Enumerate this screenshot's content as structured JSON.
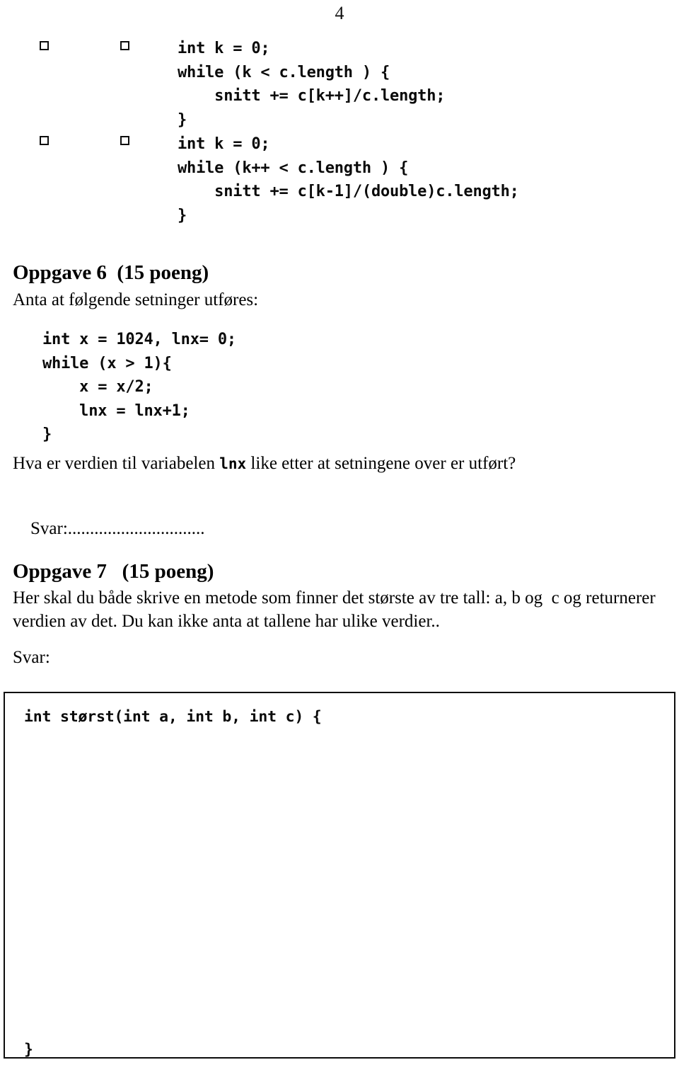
{
  "document": {
    "page_number": "4",
    "language": "no"
  },
  "checkbox_rows": [
    {
      "name": "alternative-c",
      "checkbox_left_state": "unchecked",
      "checkbox_right_state": "unchecked",
      "code": "int k = 0;\nwhile (k < c.length ) {\n    snitt += c[k++]/c.length;\n}"
    },
    {
      "name": "alternative-d",
      "checkbox_left_state": "unchecked",
      "checkbox_right_state": "unchecked",
      "code": "int k = 0;\nwhile (k++ < c.length ) {\n    snitt += c[k-1]/(double)c.length;\n}"
    }
  ],
  "oppgave6": {
    "heading": "Oppgave 6  (15 poeng)",
    "intro": "Anta at følgende setninger utføres:",
    "code": "int x = 1024, lnx= 0;\nwhile (x > 1){\n    x = x/2;\n    lnx = lnx+1;\n}",
    "question_before": "Hva er verdien til variabelen ",
    "question_mono": "lnx",
    "question_after": " like etter at setningene over er utført?",
    "answer_label": "Svar:",
    "answer_dots": "..............................."
  },
  "oppgave7": {
    "heading": "Oppgave 7   (15 poeng)",
    "body_line1": "Her skal du både skrive en metode som finner det største av tre tall: a, b og  c og returnerer",
    "body_line2": "verdien av det. Du kan ikke anta at tallene har ulike verdier..",
    "answer_label": "Svar:",
    "answer_box": {
      "signature": "int størst(int a, int b, int c) {",
      "closing_brace": "}"
    }
  }
}
